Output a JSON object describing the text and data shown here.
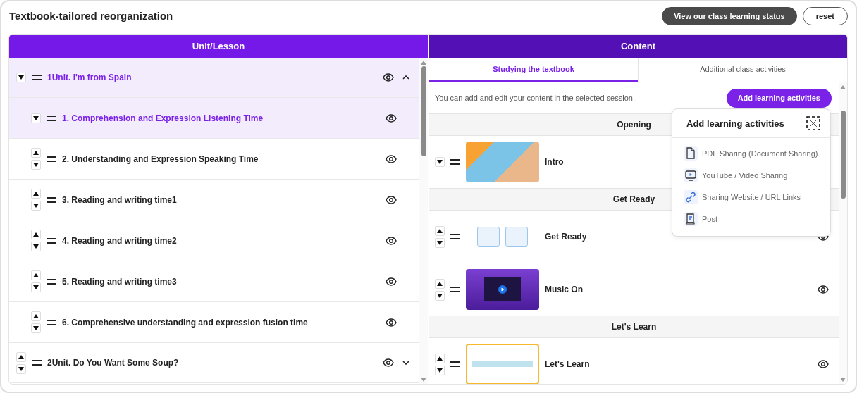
{
  "title": "Textbook-tailored reorganization",
  "buttons": [
    {
      "label": "View our class learning status",
      "kind": "dark"
    },
    {
      "label": "reset",
      "kind": "outline"
    }
  ],
  "units_panel": {
    "header": "Unit/Lesson",
    "units": [
      {
        "label": "1Unit.  I'm from Spain",
        "selected": true,
        "expanded": true,
        "up": false,
        "lessons": [
          {
            "label": "1.  Comprehension and Expression Listening Time",
            "selected": true,
            "up": false
          },
          {
            "label": "2.  Understanding and Expression Speaking Time",
            "selected": false,
            "up": true
          },
          {
            "label": "3.  Reading and writing time1",
            "selected": false,
            "up": true
          },
          {
            "label": "4.  Reading and writing time2",
            "selected": false,
            "up": true
          },
          {
            "label": "5.  Reading and writing time3",
            "selected": false,
            "up": true
          },
          {
            "label": "6.  Comprehensive understanding and expression fusion time",
            "selected": false,
            "up": true
          }
        ]
      },
      {
        "label": "2Unit.  Do You Want Some Soup?",
        "selected": false,
        "expanded": false,
        "up": true
      }
    ]
  },
  "content_panel": {
    "header": "Content",
    "tabs": [
      {
        "label": "Studying the textbook",
        "selected": true
      },
      {
        "label": "Additional class activities",
        "selected": false
      }
    ],
    "info": "You can add and edit your content in the selected session.",
    "add_button": "Add learning activities",
    "sections": [
      {
        "title": "Opening",
        "items": [
          {
            "label": "Intro",
            "kind": "illustration",
            "up": false
          }
        ]
      },
      {
        "title": "Get Ready",
        "items": [
          {
            "label": "Get Ready",
            "kind": "cards",
            "up": true
          },
          {
            "label": "Music On",
            "kind": "video",
            "up": true
          }
        ]
      },
      {
        "title": "Let's Learn",
        "items": [
          {
            "label": "Let's Learn",
            "kind": "frame",
            "up": true
          }
        ]
      }
    ],
    "popup": {
      "title": "Add learning activities",
      "options": [
        {
          "label": "PDF Sharing (Document Sharing)",
          "kind": "document"
        },
        {
          "label": "YouTube / Video Sharing",
          "kind": "video"
        },
        {
          "label": "Sharing Website / URL Links",
          "kind": "link"
        },
        {
          "label": "Post",
          "kind": "post"
        }
      ]
    }
  }
}
